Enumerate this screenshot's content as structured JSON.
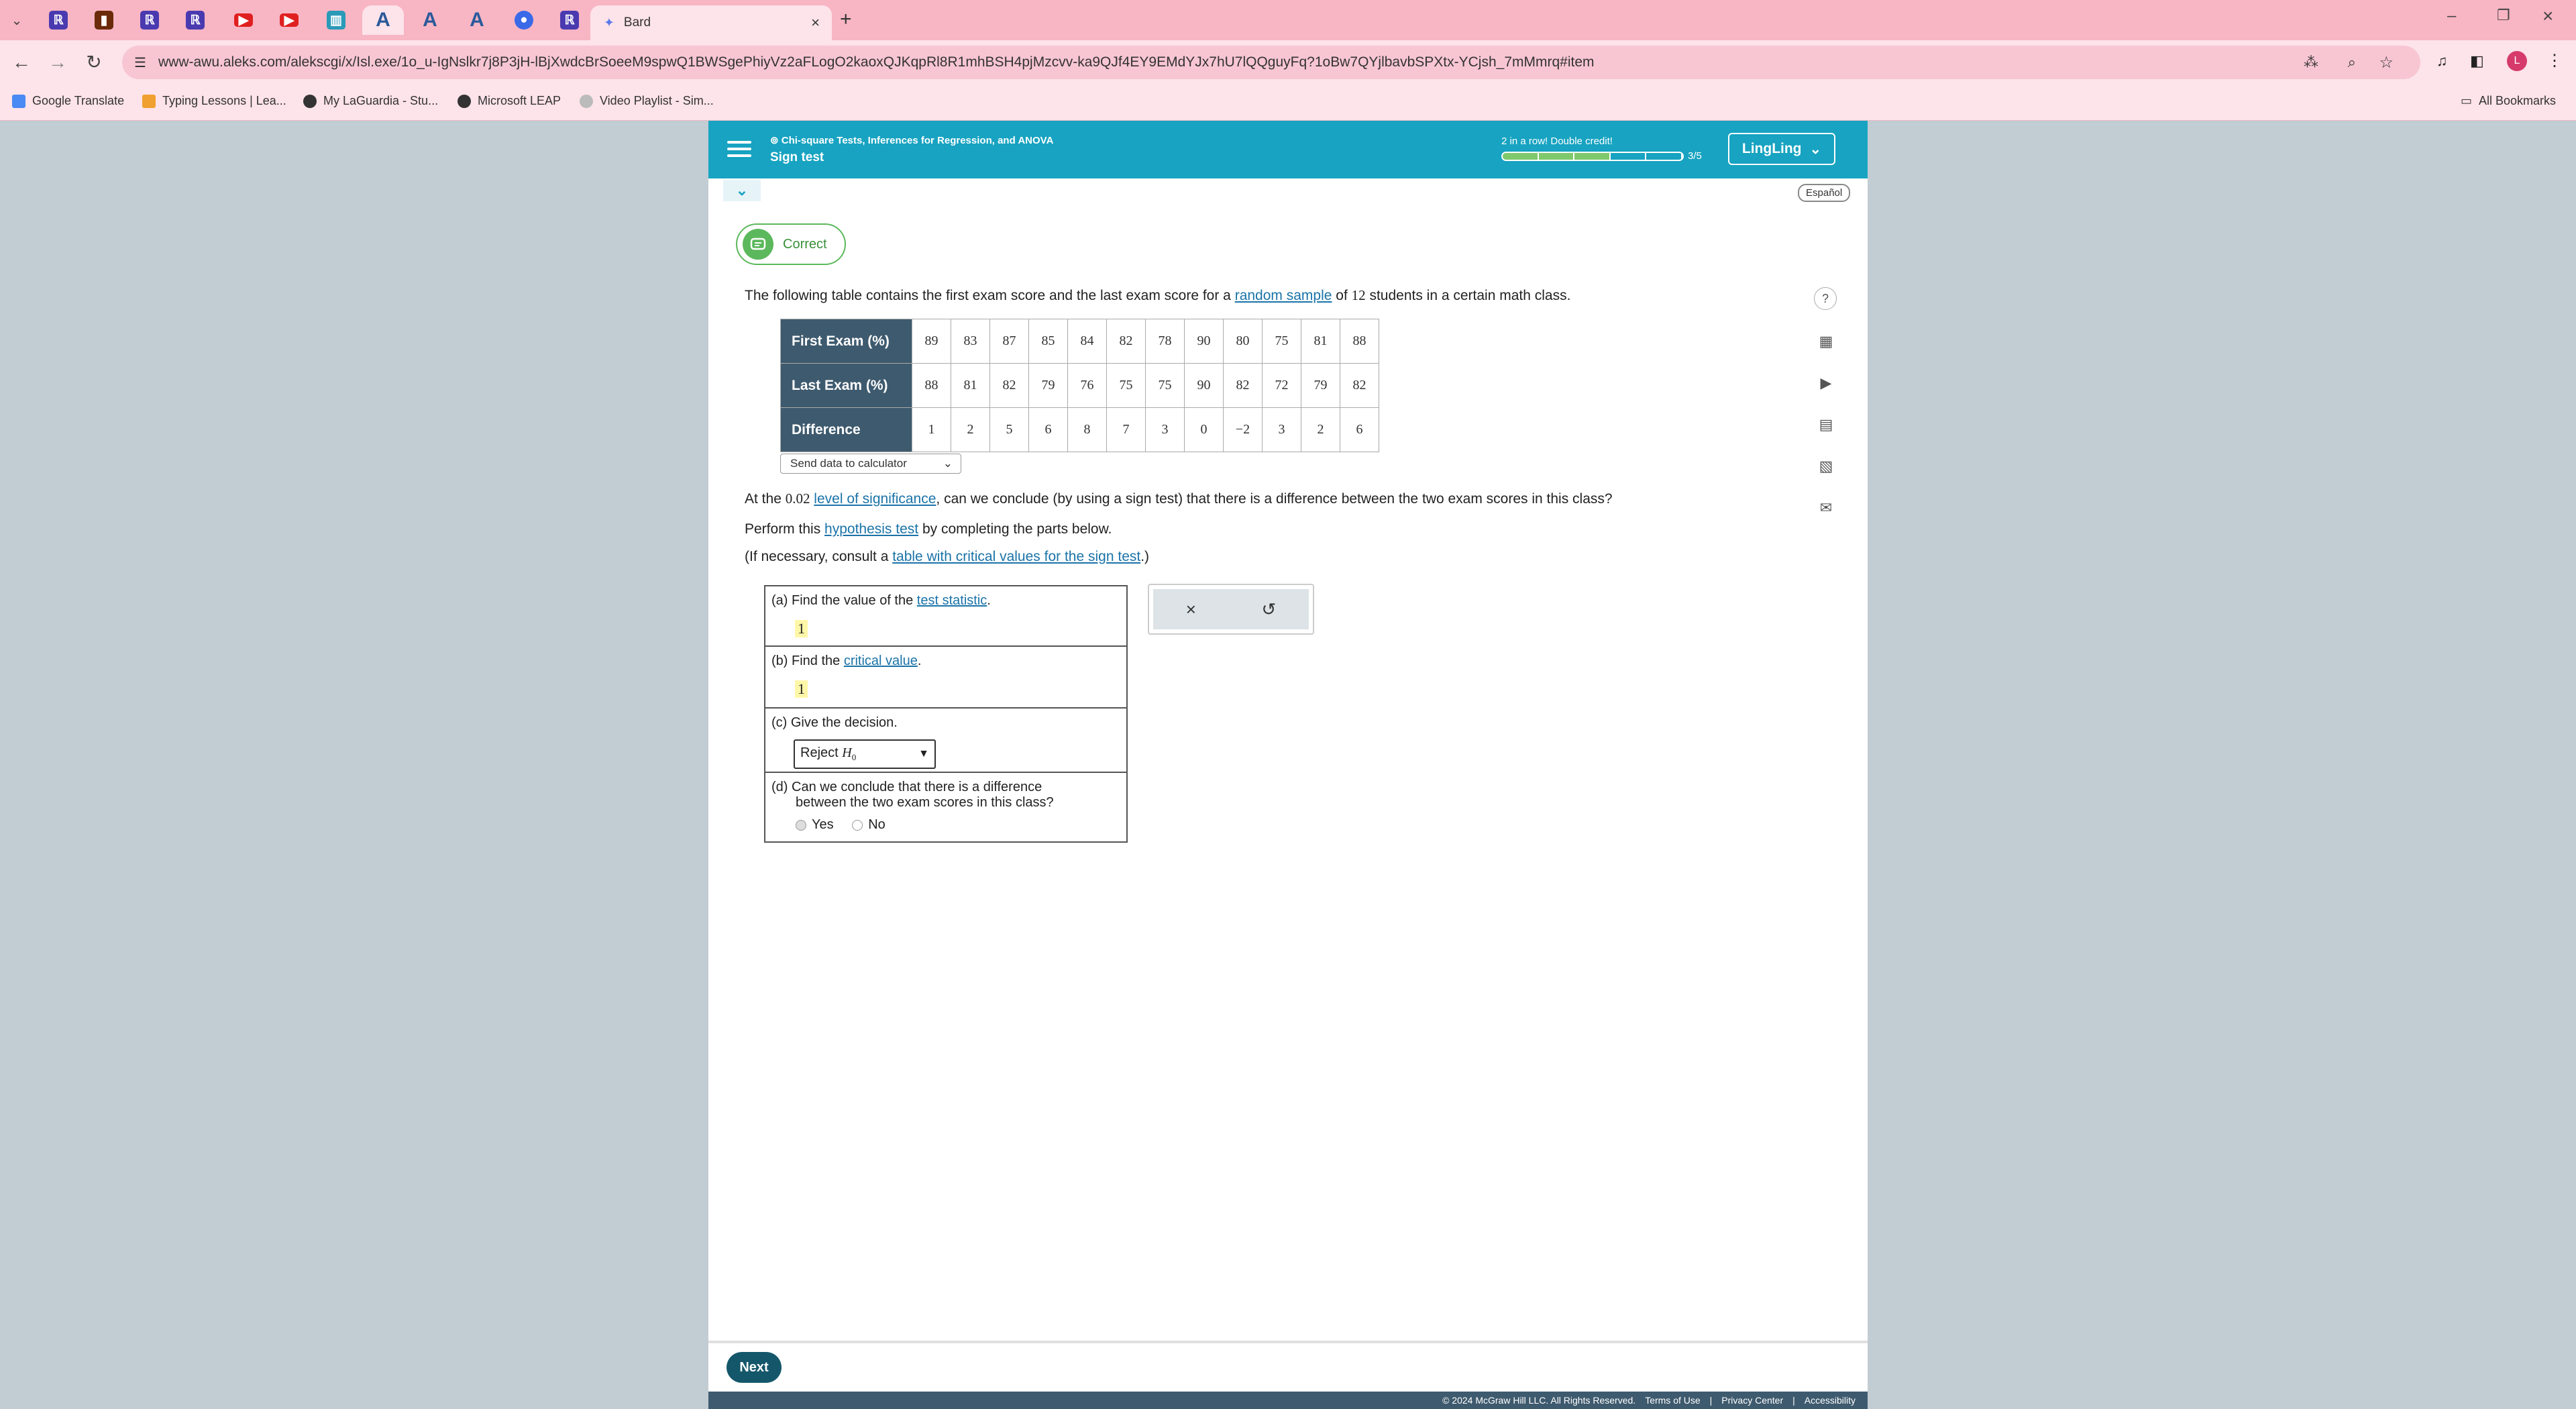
{
  "browser": {
    "active_tab_title": "Bard",
    "url": "www-awu.aleks.com/alekscgi/x/Isl.exe/1o_u-IgNslkr7j8P3jH-lBjXwdcBrSoeeM9spwQ1BWSgePhiyVz2aFLogO2kaoxQJKqpRl8R1mhBSH4pjMzcvv-ka9QJf4EY9EMdYJx7hU7lQQguyFq?1oBw7QYjlbavbSPXtx-YCjsh_7mMmrq#item",
    "bookmarks": [
      "Google Translate",
      "Typing Lessons | Lea...",
      "My LaGuardia - Stu...",
      "Microsoft LEAP",
      "Video Playlist - Sim..."
    ],
    "all_bookmarks": "All Bookmarks",
    "profile_initial": "L"
  },
  "header": {
    "topic": "Chi-square Tests, Inferences for Regression, and ANOVA",
    "subtopic": "Sign test",
    "streak": "2 in a row! Double credit!",
    "progress_count": "3/5",
    "progress_filled": 3,
    "progress_total": 5,
    "user": "LingLing"
  },
  "language_button": "Español",
  "status": "Correct",
  "intro": {
    "before": "The following table contains the first exam score and the last exam score for a ",
    "link": "random sample",
    "of": " of ",
    "n": "12",
    "after": " students in a certain math class."
  },
  "table": {
    "rows": [
      {
        "label": "First Exam (%)",
        "values": [
          "89",
          "83",
          "87",
          "85",
          "84",
          "82",
          "78",
          "90",
          "80",
          "75",
          "81",
          "88"
        ]
      },
      {
        "label": "Last Exam (%)",
        "values": [
          "88",
          "81",
          "82",
          "79",
          "76",
          "75",
          "75",
          "90",
          "82",
          "72",
          "79",
          "82"
        ]
      },
      {
        "label": "Difference",
        "values": [
          "1",
          "2",
          "5",
          "6",
          "8",
          "7",
          "3",
          "0",
          "−2",
          "3",
          "2",
          "6"
        ]
      }
    ]
  },
  "send_calc": "Send data to calculator",
  "question": {
    "at": "At the ",
    "alpha": "0.02",
    "sig_link": "level of significance",
    "rest": ", can we conclude (by using a sign test) that there is a difference between the two exam scores in this class?"
  },
  "perform": {
    "before": "Perform this ",
    "link": "hypothesis test",
    "after": " by completing the parts below."
  },
  "consult": {
    "before": "(If necessary, consult a ",
    "link": "table with critical values for the sign test",
    "after": ".)"
  },
  "parts": {
    "a": {
      "label": "(a) Find the value of the ",
      "link": "test statistic",
      "end": ".",
      "answer": "1"
    },
    "b": {
      "label": "(b) Find the ",
      "link": "critical value",
      "end": ".",
      "answer": "1"
    },
    "c": {
      "label": "(c) Give the decision.",
      "selected": "Reject",
      "selected_sym": "H",
      "selected_sub": "0"
    },
    "d": {
      "label_line1": "(d) Can we conclude that there is a difference",
      "label_line2": "between the two exam scores in this class?",
      "options": [
        "Yes",
        "No"
      ],
      "selected": "Yes"
    }
  },
  "tools": {
    "clear": "×",
    "undo": "↺"
  },
  "next": "Next",
  "footer": [
    "© 2024 McGraw Hill LLC. All Rights Reserved.",
    "Terms of Use",
    "Privacy Center",
    "Accessibility"
  ]
}
